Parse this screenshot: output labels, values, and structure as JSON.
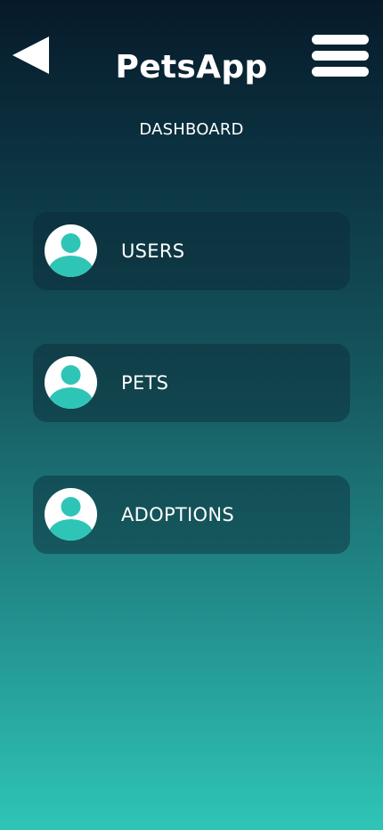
{
  "header": {
    "title": "PetsApp",
    "subtitle": "DASHBOARD",
    "back_icon": "back-triangle-icon",
    "menu_icon": "hamburger-menu-icon"
  },
  "cards": [
    {
      "label": "USERS",
      "icon": "user-avatar-icon"
    },
    {
      "label": "PETS",
      "icon": "user-avatar-icon"
    },
    {
      "label": "ADOPTIONS",
      "icon": "user-avatar-icon"
    }
  ],
  "colors": {
    "accent": "#2fc5b6",
    "gradient_top": "#071a29",
    "gradient_bottom": "#2fc5b6",
    "text": "#ffffff"
  }
}
